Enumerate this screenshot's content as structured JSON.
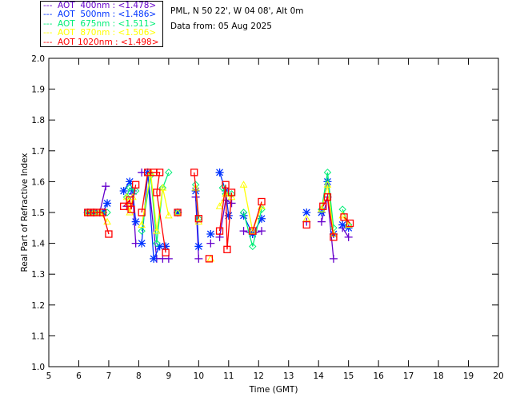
{
  "header": {
    "site": "PML, N 50 22', W 04 08', Alt 0m",
    "date": "Data from: 05 Aug 2025"
  },
  "chart_data": {
    "type": "scatter",
    "xlabel": "Time (GMT)",
    "ylabel": "Real Part of Refractive Index",
    "xlim": [
      5,
      20
    ],
    "ylim": [
      1.0,
      2.0
    ],
    "xticks": [
      "5",
      "6",
      "7",
      "8",
      "9",
      "10",
      "11",
      "12",
      "13",
      "14",
      "15",
      "16",
      "17",
      "18",
      "19",
      "20"
    ],
    "yticks": [
      "1.0",
      "1.1",
      "1.2",
      "1.3",
      "1.4",
      "1.5",
      "1.6",
      "1.7",
      "1.8",
      "1.9",
      "2.0"
    ],
    "grid": false,
    "legend_placement": "top-left",
    "series": [
      {
        "name": "AOT  400nm : <1.478>",
        "color": "#6600cc",
        "marker": "plus",
        "points": [
          [
            6.3,
            1.5
          ],
          [
            6.5,
            1.5
          ],
          [
            6.7,
            1.5
          ],
          [
            6.9,
            1.585
          ],
          null,
          [
            7.6,
            1.52
          ],
          [
            7.8,
            1.56
          ],
          [
            7.9,
            1.4
          ],
          null,
          [
            8.1,
            1.63
          ],
          [
            8.3,
            1.63
          ],
          [
            8.6,
            1.35
          ],
          [
            8.8,
            1.35
          ],
          [
            9.0,
            1.35
          ],
          null,
          [
            9.3,
            1.5
          ],
          null,
          [
            9.9,
            1.55
          ],
          [
            10.0,
            1.35
          ],
          null,
          [
            10.4,
            1.4
          ],
          null,
          [
            10.7,
            1.42
          ],
          [
            10.9,
            1.54
          ],
          [
            11.1,
            1.53
          ],
          null,
          [
            11.5,
            1.44
          ],
          [
            11.8,
            1.43
          ],
          [
            12.1,
            1.44
          ],
          null,
          [
            13.6,
            1.47
          ],
          null,
          [
            14.1,
            1.47
          ],
          [
            14.3,
            1.55
          ],
          [
            14.5,
            1.35
          ],
          null,
          [
            14.8,
            1.45
          ],
          [
            15.0,
            1.42
          ]
        ]
      },
      {
        "name": "AOT  500nm : <1.486>",
        "color": "#0033ff",
        "marker": "asterisk",
        "points": [
          [
            6.3,
            1.5
          ],
          [
            6.5,
            1.5
          ],
          [
            6.8,
            1.5
          ],
          [
            6.95,
            1.53
          ],
          null,
          [
            7.5,
            1.57
          ],
          [
            7.7,
            1.6
          ],
          [
            7.8,
            1.57
          ],
          [
            7.9,
            1.47
          ],
          null,
          [
            8.1,
            1.4
          ],
          [
            8.3,
            1.63
          ],
          [
            8.5,
            1.35
          ],
          [
            8.7,
            1.39
          ],
          [
            8.9,
            1.39
          ],
          null,
          [
            9.3,
            1.5
          ],
          null,
          [
            9.9,
            1.57
          ],
          [
            10.0,
            1.39
          ],
          null,
          [
            10.4,
            1.43
          ],
          null,
          [
            10.7,
            1.63
          ],
          [
            10.9,
            1.57
          ],
          [
            11.0,
            1.49
          ],
          null,
          [
            11.5,
            1.49
          ],
          [
            11.8,
            1.43
          ],
          [
            12.1,
            1.48
          ],
          null,
          [
            13.6,
            1.5
          ],
          null,
          [
            14.1,
            1.5
          ],
          [
            14.3,
            1.6
          ],
          [
            14.5,
            1.43
          ],
          null,
          [
            14.8,
            1.46
          ],
          [
            15.0,
            1.45
          ]
        ]
      },
      {
        "name": "AOT  675nm : <1.511>",
        "color": "#00ee77",
        "marker": "diamond",
        "points": [
          [
            6.3,
            1.5
          ],
          [
            6.5,
            1.5
          ],
          [
            6.7,
            1.5
          ],
          [
            6.95,
            1.5
          ],
          null,
          [
            7.6,
            1.55
          ],
          [
            7.7,
            1.58
          ],
          [
            7.9,
            1.57
          ],
          null,
          [
            8.1,
            1.44
          ],
          [
            8.4,
            1.62
          ],
          [
            8.6,
            1.4
          ],
          [
            8.8,
            1.58
          ],
          [
            9.0,
            1.63
          ],
          null,
          [
            9.3,
            1.5
          ],
          null,
          [
            9.9,
            1.59
          ],
          [
            10.0,
            1.48
          ],
          null,
          [
            10.8,
            1.58
          ],
          [
            10.9,
            1.56
          ],
          [
            11.1,
            1.56
          ],
          null,
          [
            11.5,
            1.5
          ],
          [
            11.8,
            1.39
          ],
          [
            12.1,
            1.51
          ],
          null,
          [
            14.1,
            1.51
          ],
          [
            14.3,
            1.63
          ],
          [
            14.5,
            1.45
          ],
          null,
          [
            14.8,
            1.51
          ],
          [
            15.0,
            1.46
          ]
        ]
      },
      {
        "name": "AOT  870nm : <1.506>",
        "color": "#ffff00",
        "marker": "triangle",
        "points": [
          [
            6.3,
            1.5
          ],
          [
            6.5,
            1.5
          ],
          [
            6.7,
            1.5
          ],
          [
            6.95,
            1.47
          ],
          null,
          [
            7.6,
            1.55
          ],
          [
            7.7,
            1.5
          ],
          [
            7.8,
            1.55
          ],
          null,
          [
            8.1,
            1.46
          ],
          [
            8.4,
            1.63
          ],
          [
            8.6,
            1.44
          ],
          [
            8.8,
            1.58
          ],
          [
            9.0,
            1.49
          ],
          null,
          [
            9.3,
            1.5
          ],
          null,
          [
            9.9,
            1.58
          ],
          [
            10.0,
            1.47
          ],
          null,
          [
            10.4,
            1.35
          ],
          null,
          [
            10.7,
            1.52
          ],
          [
            10.9,
            1.56
          ],
          [
            11.1,
            1.55
          ],
          null,
          [
            11.5,
            1.59
          ],
          [
            11.8,
            1.44
          ],
          [
            12.1,
            1.52
          ],
          null,
          [
            13.6,
            1.48
          ],
          null,
          [
            14.1,
            1.51
          ],
          [
            14.3,
            1.59
          ],
          [
            14.5,
            1.43
          ],
          null,
          [
            14.8,
            1.49
          ],
          [
            15.0,
            1.46
          ]
        ]
      },
      {
        "name": "AOT 1020nm : <1.498>",
        "color": "#ff0000",
        "marker": "square",
        "points": [
          [
            6.3,
            1.5
          ],
          [
            6.4,
            1.5
          ],
          [
            6.5,
            1.5
          ],
          [
            6.6,
            1.5
          ],
          [
            6.8,
            1.5
          ],
          [
            7.0,
            1.43
          ],
          null,
          [
            7.5,
            1.52
          ],
          [
            7.7,
            1.54
          ],
          [
            7.75,
            1.51
          ],
          [
            7.9,
            1.59
          ],
          null,
          [
            8.1,
            1.5
          ],
          [
            8.3,
            1.63
          ],
          [
            8.5,
            1.63
          ],
          [
            8.7,
            1.63
          ],
          [
            8.6,
            1.565
          ],
          [
            8.9,
            1.37
          ],
          null,
          [
            9.3,
            1.5
          ],
          null,
          [
            9.85,
            1.63
          ],
          [
            10.0,
            1.48
          ],
          null,
          [
            10.35,
            1.35
          ],
          null,
          [
            10.7,
            1.44
          ],
          [
            10.9,
            1.59
          ],
          [
            10.95,
            1.38
          ],
          [
            11.1,
            1.565
          ],
          null,
          [
            11.8,
            1.44
          ],
          [
            12.1,
            1.535
          ],
          null,
          [
            13.6,
            1.46
          ],
          null,
          [
            14.15,
            1.52
          ],
          [
            14.3,
            1.55
          ],
          [
            14.5,
            1.42
          ],
          null,
          [
            14.85,
            1.485
          ],
          [
            15.05,
            1.465
          ]
        ]
      }
    ]
  }
}
